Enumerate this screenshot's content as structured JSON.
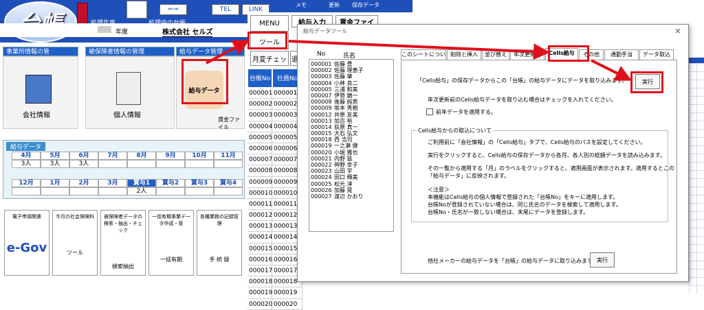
{
  "topbar": {
    "logo": "台帳",
    "proc_year_label": "処理年度",
    "proc_book_label": "処理中の台帳",
    "year_suffix": "年度",
    "company": "株式会社 セルズ",
    "tel": "TEL",
    "link": "LINK",
    "memo": "メモ",
    "update": "更新",
    "save_data": "保存データ"
  },
  "menu_strip": {
    "menu": "MENU",
    "kyuyo_input": "給与入力",
    "chingin_file": "賃金ファイ",
    "tool": "ツール",
    "henkou": "月変チェッ",
    "tai": "退"
  },
  "panels": {
    "office": "事業所情報の管",
    "insured": "被保険者情報の管理",
    "salary": "給与データ管理",
    "company_info": "会社情報",
    "personal_info": "個人情報",
    "salary_data": "給与データ",
    "wage_file": "賃金ファイル"
  },
  "salary_table": {
    "title": "給与データ",
    "row1_months": [
      "4月",
      "5月",
      "6月",
      "7月",
      "8月",
      "9月",
      "10月",
      "11月"
    ],
    "row1_counts": [
      "3人",
      "3人",
      "3人",
      "",
      "",
      "",
      "",
      ""
    ],
    "row2_months": [
      "12月",
      "1月",
      "2月",
      "3月",
      "賞与1",
      "賞与2",
      "賞与3",
      "賞与4"
    ],
    "row2_counts": [
      "",
      "",
      "",
      "",
      "2人",
      "",
      "",
      ""
    ]
  },
  "bottom_buttons": [
    {
      "title": "電子申請関連",
      "label": "e-Gov"
    },
    {
      "title": "今月の社会保険料",
      "label": "ツール"
    },
    {
      "title": "被保険者データの検索・抽出・チェック",
      "label": "検索抽出"
    },
    {
      "title": "一括有期事業データ作成・管",
      "label": "一括有期"
    },
    {
      "title": "各種業務の記録管理",
      "label": "手 続 録"
    }
  ],
  "sheet": {
    "col1": "台帳No",
    "col2": "社員No",
    "rows": [
      "000001",
      "000002",
      "000003",
      "000004",
      "000005",
      "000006",
      "000007",
      "000008",
      "000009",
      "000010",
      "000011",
      "000012",
      "000013",
      "000014",
      "000015",
      "000016",
      "000017",
      "000018",
      "000019",
      "000020"
    ]
  },
  "dialog": {
    "title": "給与データツール",
    "close": "×",
    "list_head_no": "No",
    "list_head_name": "氏名",
    "employees": [
      {
        "no": "000001",
        "name": "佐藤 豊"
      },
      {
        "no": "000002",
        "name": "佐藤 理恵子"
      },
      {
        "no": "000003",
        "name": "佐藤 肇"
      },
      {
        "no": "000004",
        "name": "小林 良二"
      },
      {
        "no": "000005",
        "name": "三浦 和美"
      },
      {
        "no": "000007",
        "name": "伊勢 鎮一"
      },
      {
        "no": "000008",
        "name": "後藤 純男"
      },
      {
        "no": "000009",
        "name": "坂本 秀樹"
      },
      {
        "no": "000012",
        "name": "井原 友美"
      },
      {
        "no": "000013",
        "name": "加古 裕"
      },
      {
        "no": "000014",
        "name": "荻原 真一"
      },
      {
        "no": "000015",
        "name": "大石 弘文"
      },
      {
        "no": "000018",
        "name": "西 浩司"
      },
      {
        "no": "000019",
        "name": "一之瀬 健"
      },
      {
        "no": "000020",
        "name": "小堀 雅也"
      },
      {
        "no": "000021",
        "name": "内野 猛"
      },
      {
        "no": "000022",
        "name": "神野 幸子"
      },
      {
        "no": "000023",
        "name": "山田 学"
      },
      {
        "no": "000024",
        "name": "田口 輝美"
      },
      {
        "no": "000025",
        "name": "松元 淳"
      },
      {
        "no": "000026",
        "name": "加藤 晃"
      },
      {
        "no": "000027",
        "name": "渡辺 かおり"
      }
    ],
    "tabs": [
      "このシートについて",
      "削除と挿入",
      "並び替え",
      "年次更新前",
      "Cells給与",
      "その他",
      "通勤手当",
      "データ取込"
    ],
    "intro": "「Cells給与」の保存データからこの「台帳」の給与データにデータを取り込みます。",
    "execute": "実行",
    "check_note": "年次更新前のCells給与データを取り込む場合はチェックを入れてください。",
    "checkbox_label": "前年データを適用する。",
    "group_title": "Cells給与からの取込について",
    "group_lines": [
      "ご利用前に「会社情報」の「Cells給与」タブで、Cells給与のパスを設定してください。",
      "実行をクリックすると、Cells給与の保存データから各月、各人別の総額データを読み込みます。",
      "その一覧から適用する「月」のラベルをクリックすると、適用画面が表示されます。適用するとこの",
      "「給与データ」に反映されます。"
    ],
    "notice_title": "＜注意＞",
    "notice_lines": [
      "本機能はCells給与の個人情報で登録された「台帳No」をキーに適用します。",
      "台帳Noが登録されていない場合は、同じ氏名のデータを検索して適用します。",
      "台帳No・氏名が一致しない場合は、末尾にデータを登録します。"
    ],
    "other_text": "他社メーカーの給与データを「台帳」の給与データに取り込みます。",
    "execute2": "実行"
  },
  "colors": {
    "accent": "#1f4fb8",
    "highlight": "#e0101a"
  }
}
